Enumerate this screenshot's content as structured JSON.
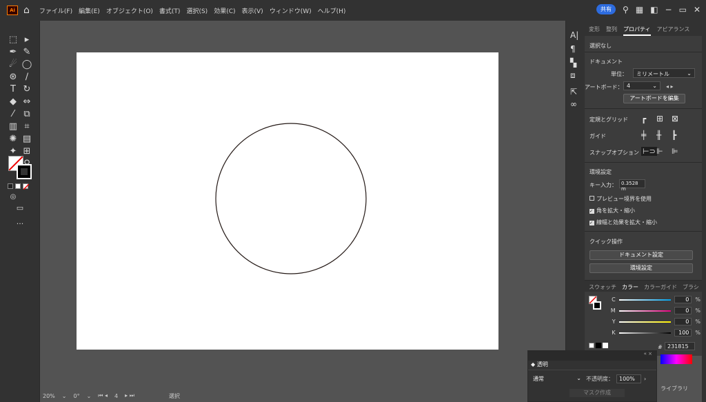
{
  "app": {
    "logo": "Ai"
  },
  "menu": [
    "ファイル(F)",
    "編集(E)",
    "オブジェクト(O)",
    "書式(T)",
    "選択(S)",
    "効果(C)",
    "表示(V)",
    "ウィンドウ(W)",
    "ヘルプ(H)"
  ],
  "topbar": {
    "share_label": "共有",
    "search_icon": "search-icon",
    "layout_icon": "layout-icon",
    "window_icon": "window-icon",
    "minimize": "−",
    "restore": "▭",
    "close": "✕"
  },
  "status": {
    "zoom": "20%",
    "angle": "0°",
    "artboard": "4",
    "tool": "選択"
  },
  "properties": {
    "tabs": [
      "変形",
      "整列",
      "プロパティ",
      "アピアランス"
    ],
    "active_tab": "プロパティ",
    "selection": "選択なし",
    "document_heading": "ドキュメント",
    "unit_label": "単位：",
    "unit_value": "ミリメートル",
    "artboard_label": "アートボード：",
    "artboard_value": "4",
    "edit_artboards_button": "アートボードを編集",
    "rulers_grid": "定規とグリッド",
    "guides": "ガイド",
    "snap_options": "スナップオプション",
    "preferences_heading": "環境設定",
    "keyboard_increment_label": "キー入力：",
    "keyboard_increment_value": "0.3528 m",
    "preview_bounds": "プレビュー境界を使用",
    "scale_corners": "角を拡大・縮小",
    "scale_strokes": "線幅と効果を拡大・縮小",
    "quick_actions": "クイック操作",
    "document_setup_button": "ドキュメント設定",
    "preferences_button": "環境設定"
  },
  "color_panel": {
    "tabs": [
      "スウォッチ",
      "カラー",
      "カラーガイド",
      "ブラシ"
    ],
    "active_tab": "カラー",
    "c_label": "C",
    "c_value": "0",
    "m_label": "M",
    "m_value": "0",
    "y_label": "Y",
    "y_value": "0",
    "k_label": "K",
    "k_value": "100",
    "percent": "%",
    "hex_label": "#",
    "hex_value": "231815"
  },
  "transparency_panel": {
    "tab": "透明",
    "blend_mode": "通常",
    "opacity_label": "不透明度：",
    "opacity_value": "100%",
    "make_mask_button": "マスク作成",
    "libraries": "ライブラリ"
  },
  "colors": {
    "accent": "#2d6cdf",
    "panel": "#3c3c3c",
    "dark": "#323232",
    "canvas": "#535353"
  }
}
